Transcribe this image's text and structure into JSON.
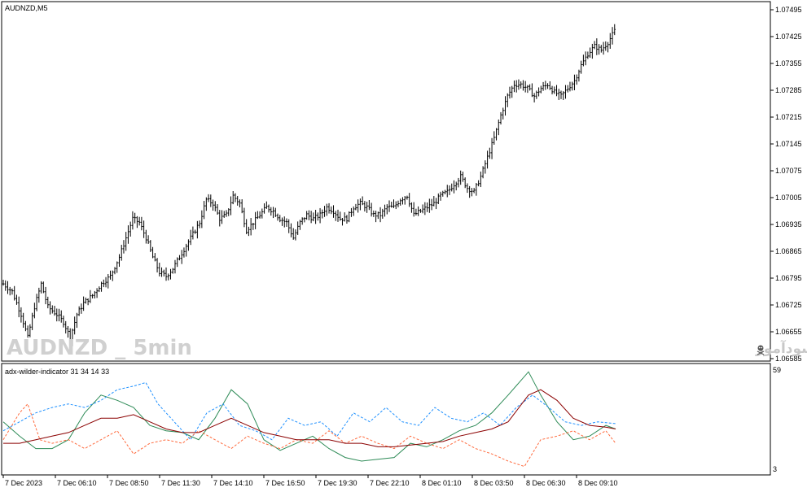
{
  "main_chart": {
    "title": "AUDNZD,M5",
    "watermark": "AUDNZD _ 5min",
    "watermark_site": "انتشار در سایت سودآموز",
    "price_axis_labels": [
      "1.07495",
      "1.07425",
      "1.07355",
      "1.07285",
      "1.07215",
      "1.07145",
      "1.07075",
      "1.07005",
      "1.06935",
      "1.06865",
      "1.06795",
      "1.06725",
      "1.06655",
      "1.06585"
    ]
  },
  "indicator": {
    "title": "adx-wilder-indicator 31 34 14 33",
    "scale_max": "59",
    "scale_min": "3"
  },
  "time_axis_labels": [
    "7 Dec 2023",
    "7 Dec 06:10",
    "7 Dec 08:50",
    "7 Dec 11:30",
    "7 Dec 14:10",
    "7 Dec 16:50",
    "7 Dec 19:30",
    "7 Dec 22:10",
    "8 Dec 01:10",
    "8 Dec 03:50",
    "8 Dec 06:30",
    "8 Dec 09:10"
  ],
  "colors": {
    "bars": "#000000",
    "adx": "#2e8b57",
    "di_plus": "#1e90ff",
    "di_minus": "#ff6a3d",
    "signal": "#8b0000",
    "watermark": "#d0d0d0"
  },
  "chart_data": {
    "type": "line",
    "price_path": [
      [
        0,
        1.0678
      ],
      [
        4,
        1.0676
      ],
      [
        8,
        1.067
      ],
      [
        11,
        1.0664
      ],
      [
        14,
        1.0672
      ],
      [
        17,
        1.0678
      ],
      [
        20,
        1.0672
      ],
      [
        24,
        1.067
      ],
      [
        27,
        1.0668
      ],
      [
        30,
        1.0664
      ],
      [
        33,
        1.067
      ],
      [
        36,
        1.0673
      ],
      [
        40,
        1.0675
      ],
      [
        44,
        1.0678
      ],
      [
        48,
        1.068
      ],
      [
        52,
        1.0685
      ],
      [
        55,
        1.069
      ],
      [
        58,
        1.0695
      ],
      [
        61,
        1.0694
      ],
      [
        64,
        1.069
      ],
      [
        67,
        1.0685
      ],
      [
        70,
        1.0681
      ],
      [
        73,
        1.068
      ],
      [
        76,
        1.0682
      ],
      [
        79,
        1.0685
      ],
      [
        82,
        1.0688
      ],
      [
        85,
        1.0691
      ],
      [
        88,
        1.0694
      ],
      [
        91,
        1.07
      ],
      [
        94,
        1.0699
      ],
      [
        97,
        1.0695
      ],
      [
        100,
        1.0696
      ],
      [
        103,
        1.0701
      ],
      [
        106,
        1.0699
      ],
      [
        109,
        1.0692
      ],
      [
        112,
        1.0694
      ],
      [
        115,
        1.0696
      ],
      [
        118,
        1.0698
      ],
      [
        121,
        1.0697
      ],
      [
        124,
        1.0695
      ],
      [
        127,
        1.0694
      ],
      [
        130,
        1.069
      ],
      [
        133,
        1.0694
      ],
      [
        136,
        1.0696
      ],
      [
        139,
        1.0695
      ],
      [
        142,
        1.0696
      ],
      [
        145,
        1.0698
      ],
      [
        148,
        1.0697
      ],
      [
        151,
        1.0695
      ],
      [
        154,
        1.0695
      ],
      [
        157,
        1.0698
      ],
      [
        160,
        1.0699
      ],
      [
        163,
        1.0698
      ],
      [
        166,
        1.0696
      ],
      [
        169,
        1.0696
      ],
      [
        172,
        1.0698
      ],
      [
        175,
        1.0698
      ],
      [
        178,
        1.07
      ],
      [
        181,
        1.0701
      ],
      [
        184,
        1.0696
      ],
      [
        187,
        1.0697
      ],
      [
        190,
        1.0698
      ],
      [
        193,
        1.0699
      ],
      [
        196,
        1.0701
      ],
      [
        199,
        1.0702
      ],
      [
        202,
        1.0704
      ],
      [
        205,
        1.0706
      ],
      [
        208,
        1.0703
      ],
      [
        211,
        1.0702
      ],
      [
        214,
        1.0706
      ],
      [
        217,
        1.0711
      ],
      [
        220,
        1.0716
      ],
      [
        223,
        1.0722
      ],
      [
        226,
        1.0727
      ],
      [
        229,
        1.073
      ],
      [
        232,
        1.073
      ],
      [
        235,
        1.0729
      ],
      [
        238,
        1.0727
      ],
      [
        241,
        1.0729
      ],
      [
        244,
        1.073
      ],
      [
        247,
        1.0728
      ],
      [
        250,
        1.0727
      ],
      [
        253,
        1.0729
      ],
      [
        256,
        1.0731
      ],
      [
        259,
        1.0735
      ],
      [
        262,
        1.0738
      ],
      [
        265,
        1.074
      ],
      [
        268,
        1.0739
      ],
      [
        271,
        1.0741
      ],
      [
        274,
        1.0744
      ]
    ],
    "indicator_series": [
      {
        "key": "adx",
        "values": [
          [
            0,
            30
          ],
          [
            20,
            22
          ],
          [
            40,
            15
          ],
          [
            60,
            15
          ],
          [
            80,
            20
          ],
          [
            100,
            35
          ],
          [
            120,
            45
          ],
          [
            140,
            42
          ],
          [
            160,
            38
          ],
          [
            180,
            28
          ],
          [
            200,
            25
          ],
          [
            220,
            24
          ],
          [
            240,
            20
          ],
          [
            260,
            32
          ],
          [
            280,
            48
          ],
          [
            300,
            40
          ],
          [
            320,
            20
          ],
          [
            340,
            14
          ],
          [
            360,
            18
          ],
          [
            380,
            22
          ],
          [
            400,
            15
          ],
          [
            420,
            10
          ],
          [
            440,
            8
          ],
          [
            460,
            9
          ],
          [
            480,
            10
          ],
          [
            500,
            18
          ],
          [
            520,
            16
          ],
          [
            540,
            20
          ],
          [
            560,
            25
          ],
          [
            580,
            28
          ],
          [
            600,
            35
          ],
          [
            620,
            45
          ],
          [
            645,
            58
          ],
          [
            660,
            45
          ],
          [
            680,
            30
          ],
          [
            700,
            20
          ],
          [
            720,
            22
          ],
          [
            740,
            28
          ],
          [
            752,
            26
          ]
        ]
      },
      {
        "key": "di_plus",
        "values": [
          [
            0,
            25
          ],
          [
            20,
            30
          ],
          [
            40,
            35
          ],
          [
            60,
            38
          ],
          [
            80,
            40
          ],
          [
            100,
            38
          ],
          [
            120,
            42
          ],
          [
            140,
            48
          ],
          [
            160,
            50
          ],
          [
            175,
            52
          ],
          [
            190,
            40
          ],
          [
            210,
            30
          ],
          [
            230,
            20
          ],
          [
            250,
            35
          ],
          [
            270,
            40
          ],
          [
            290,
            28
          ],
          [
            310,
            25
          ],
          [
            330,
            20
          ],
          [
            350,
            32
          ],
          [
            370,
            28
          ],
          [
            390,
            30
          ],
          [
            410,
            22
          ],
          [
            430,
            35
          ],
          [
            450,
            30
          ],
          [
            470,
            38
          ],
          [
            490,
            30
          ],
          [
            510,
            28
          ],
          [
            530,
            38
          ],
          [
            550,
            32
          ],
          [
            570,
            30
          ],
          [
            590,
            35
          ],
          [
            610,
            28
          ],
          [
            630,
            38
          ],
          [
            650,
            45
          ],
          [
            670,
            38
          ],
          [
            690,
            30
          ],
          [
            710,
            28
          ],
          [
            730,
            30
          ],
          [
            752,
            29
          ]
        ]
      },
      {
        "key": "di_minus",
        "values": [
          [
            0,
            20
          ],
          [
            20,
            35
          ],
          [
            30,
            40
          ],
          [
            45,
            20
          ],
          [
            60,
            18
          ],
          [
            80,
            20
          ],
          [
            100,
            15
          ],
          [
            120,
            20
          ],
          [
            140,
            25
          ],
          [
            160,
            12
          ],
          [
            180,
            18
          ],
          [
            200,
            20
          ],
          [
            220,
            18
          ],
          [
            240,
            25
          ],
          [
            260,
            20
          ],
          [
            280,
            15
          ],
          [
            300,
            22
          ],
          [
            320,
            18
          ],
          [
            340,
            15
          ],
          [
            360,
            20
          ],
          [
            380,
            18
          ],
          [
            400,
            25
          ],
          [
            420,
            18
          ],
          [
            440,
            22
          ],
          [
            460,
            18
          ],
          [
            480,
            15
          ],
          [
            500,
            22
          ],
          [
            520,
            18
          ],
          [
            540,
            15
          ],
          [
            560,
            20
          ],
          [
            580,
            15
          ],
          [
            600,
            12
          ],
          [
            620,
            8
          ],
          [
            640,
            5
          ],
          [
            660,
            20
          ],
          [
            680,
            22
          ],
          [
            700,
            25
          ],
          [
            720,
            20
          ],
          [
            740,
            25
          ],
          [
            752,
            18
          ]
        ]
      },
      {
        "key": "signal",
        "values": [
          [
            0,
            18
          ],
          [
            20,
            18
          ],
          [
            40,
            20
          ],
          [
            60,
            22
          ],
          [
            80,
            24
          ],
          [
            100,
            28
          ],
          [
            120,
            32
          ],
          [
            140,
            32
          ],
          [
            160,
            34
          ],
          [
            180,
            30
          ],
          [
            200,
            26
          ],
          [
            220,
            24
          ],
          [
            240,
            24
          ],
          [
            260,
            28
          ],
          [
            280,
            32
          ],
          [
            300,
            28
          ],
          [
            320,
            24
          ],
          [
            340,
            22
          ],
          [
            360,
            20
          ],
          [
            380,
            20
          ],
          [
            400,
            20
          ],
          [
            420,
            18
          ],
          [
            440,
            18
          ],
          [
            460,
            16
          ],
          [
            480,
            16
          ],
          [
            500,
            17
          ],
          [
            520,
            18
          ],
          [
            540,
            19
          ],
          [
            560,
            22
          ],
          [
            580,
            24
          ],
          [
            600,
            26
          ],
          [
            620,
            30
          ],
          [
            645,
            45
          ],
          [
            660,
            48
          ],
          [
            680,
            42
          ],
          [
            700,
            32
          ],
          [
            720,
            28
          ],
          [
            740,
            27
          ],
          [
            752,
            26
          ]
        ]
      }
    ]
  }
}
